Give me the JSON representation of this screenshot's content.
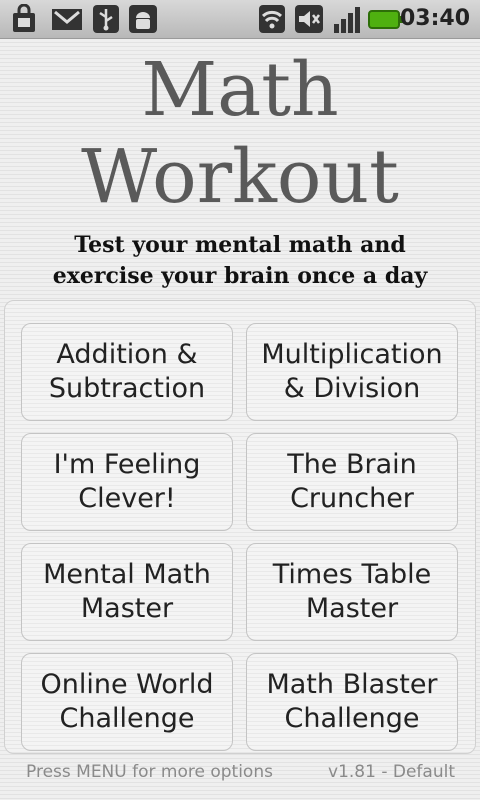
{
  "status_bar": {
    "time": "03:40",
    "left_icons": [
      "shopping-bag-icon",
      "gmail-icon",
      "usb-icon",
      "android-debug-icon"
    ],
    "right_icons": [
      "wifi-icon",
      "mute-icon",
      "signal-icon",
      "battery-icon"
    ]
  },
  "header": {
    "title_line1": "Math",
    "title_line2": "Workout",
    "subtitle_line1": "Test your mental math and",
    "subtitle_line2": "exercise your brain once a day"
  },
  "menu": {
    "buttons": [
      {
        "line1": "Addition &",
        "line2": "Subtraction"
      },
      {
        "line1": "Multiplication",
        "line2": "& Division"
      },
      {
        "line1": "I'm Feeling",
        "line2": "Clever!"
      },
      {
        "line1": "The Brain",
        "line2": "Cruncher"
      },
      {
        "line1": "Mental Math",
        "line2": "Master"
      },
      {
        "line1": "Times Table",
        "line2": "Master"
      },
      {
        "line1": "Online World",
        "line2": "Challenge"
      },
      {
        "line1": "Math Blaster",
        "line2": "Challenge"
      }
    ]
  },
  "footer": {
    "hint": "Press MENU for more options",
    "version": "v1.81 - Default"
  }
}
